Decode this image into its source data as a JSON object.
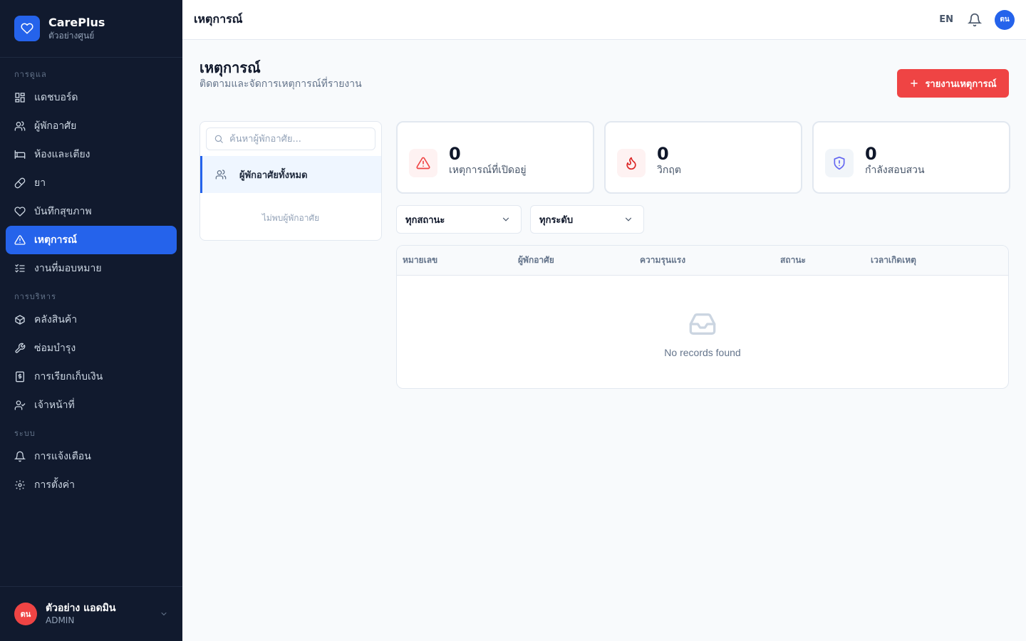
{
  "brand": {
    "name": "CarePlus",
    "subtitle": "ตัวอย่างศูนย์"
  },
  "sidebar": {
    "sections": [
      {
        "title": "การดูแล",
        "items": [
          "แดชบอร์ด",
          "ผู้พักอาศัย",
          "ห้องและเตียง",
          "ยา",
          "บันทึกสุขภาพ",
          "เหตุการณ์",
          "งานที่มอบหมาย"
        ]
      },
      {
        "title": "การบริหาร",
        "items": [
          "คลังสินค้า",
          "ซ่อมบำรุง",
          "การเรียกเก็บเงิน",
          "เจ้าหน้าที่"
        ]
      },
      {
        "title": "ระบบ",
        "items": [
          "การแจ้งเตือน",
          "การตั้งค่า"
        ]
      }
    ],
    "active_item": "เหตุการณ์"
  },
  "user": {
    "initials": "ตน",
    "name": "ตัวอย่าง แอดมิน",
    "role": "ADMIN"
  },
  "topbar": {
    "title": "เหตุการณ์",
    "lang": "EN",
    "avatar_initials": "ตน"
  },
  "page": {
    "title": "เหตุการณ์",
    "subtitle": "ติดตามและจัดการเหตุการณ์ที่รายงาน",
    "report_button": "รายงานเหตุการณ์"
  },
  "residents": {
    "search_placeholder": "ค้นหาผู้พักอาศัย...",
    "all_label": "ผู้พักอาศัยทั้งหมด",
    "empty": "ไม่พบผู้พักอาศัย"
  },
  "stats": [
    {
      "value": "0",
      "label": "เหตุการณ์ที่เปิดอยู่",
      "color": "#ef4444",
      "bg": "#fef2f2",
      "icon": "alert-triangle-icon"
    },
    {
      "value": "0",
      "label": "วิกฤต",
      "color": "#dc2626",
      "bg": "#fef2f2",
      "icon": "flame-icon"
    },
    {
      "value": "0",
      "label": "กำลังสอบสวน",
      "color": "#6366f1",
      "bg": "#f1f5f9",
      "icon": "shield-icon"
    }
  ],
  "filters": {
    "status": "ทุกสถานะ",
    "severity": "ทุกระดับ"
  },
  "table": {
    "columns": [
      "หมายเลข",
      "ผู้พักอาศัย",
      "ความรุนแรง",
      "สถานะ",
      "เวลาเกิดเหตุ"
    ],
    "empty": "No records found"
  },
  "colors": {
    "sidebar_bg": "#111a2e",
    "accent": "#2563eb",
    "danger": "#ef4444"
  }
}
